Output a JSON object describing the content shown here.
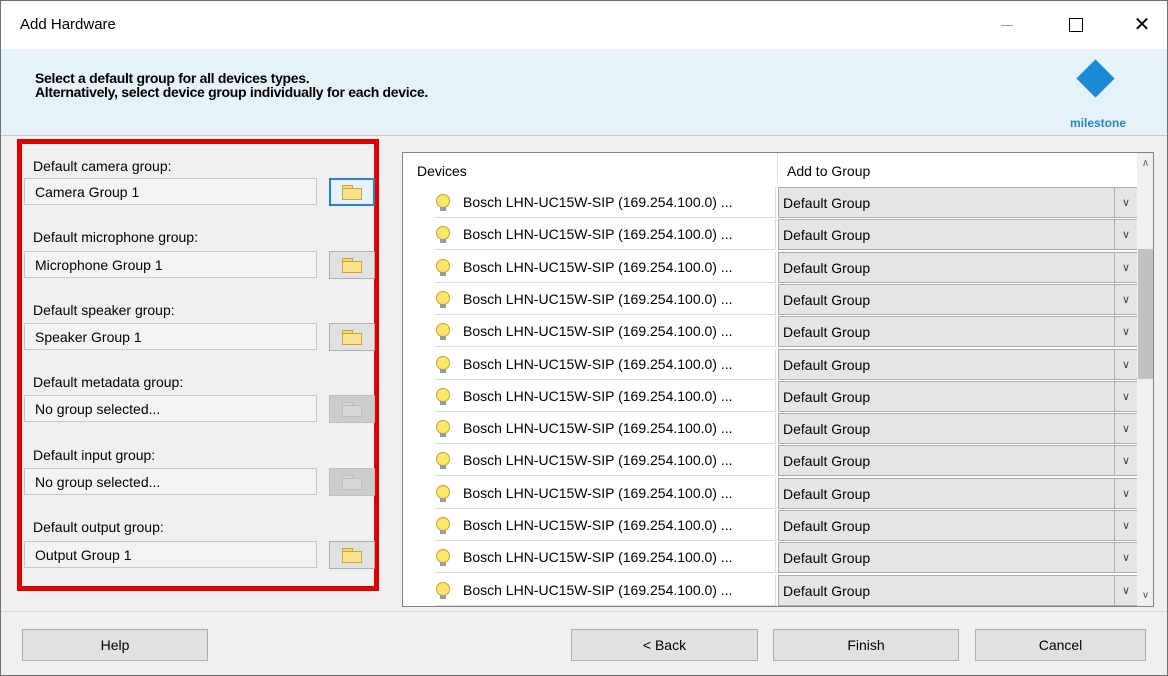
{
  "window": {
    "title": "Add Hardware"
  },
  "header": {
    "line1": "Select a default group for all devices types.",
    "line2": "Alternatively, select device group individually for each device.",
    "logo_text": "milestone",
    "logo_color": "#1a8ad4"
  },
  "defaults": [
    {
      "label": "Default camera group:",
      "value": "Camera Group 1",
      "button_enabled": true
    },
    {
      "label": "Default microphone group:",
      "value": "Microphone Group 1",
      "button_enabled": true
    },
    {
      "label": "Default speaker group:",
      "value": "Speaker Group 1",
      "button_enabled": true
    },
    {
      "label": "Default metadata group:",
      "value": "No group selected...",
      "button_enabled": false
    },
    {
      "label": "Default input group:",
      "value": "No group selected...",
      "button_enabled": false
    },
    {
      "label": "Default output group:",
      "value": "Output Group 1",
      "button_enabled": true
    }
  ],
  "table": {
    "col_devices": "Devices",
    "col_group": "Add to Group",
    "rows": [
      {
        "device": "Bosch LHN-UC15W-SIP (169.254.100.0) ...",
        "group": "Default Group"
      },
      {
        "device": "Bosch LHN-UC15W-SIP (169.254.100.0) ...",
        "group": "Default Group"
      },
      {
        "device": "Bosch LHN-UC15W-SIP (169.254.100.0) ...",
        "group": "Default Group"
      },
      {
        "device": "Bosch LHN-UC15W-SIP (169.254.100.0) ...",
        "group": "Default Group"
      },
      {
        "device": "Bosch LHN-UC15W-SIP (169.254.100.0) ...",
        "group": "Default Group"
      },
      {
        "device": "Bosch LHN-UC15W-SIP (169.254.100.0) ...",
        "group": "Default Group"
      },
      {
        "device": "Bosch LHN-UC15W-SIP (169.254.100.0) ...",
        "group": "Default Group"
      },
      {
        "device": "Bosch LHN-UC15W-SIP (169.254.100.0) ...",
        "group": "Default Group"
      },
      {
        "device": "Bosch LHN-UC15W-SIP (169.254.100.0) ...",
        "group": "Default Group"
      },
      {
        "device": "Bosch LHN-UC15W-SIP (169.254.100.0) ...",
        "group": "Default Group"
      },
      {
        "device": "Bosch LHN-UC15W-SIP (169.254.100.0) ...",
        "group": "Default Group"
      },
      {
        "device": "Bosch LHN-UC15W-SIP (169.254.100.0) ...",
        "group": "Default Group"
      },
      {
        "device": "Bosch LHN-UC15W-SIP (169.254.100.0) ...",
        "group": "Default Group"
      }
    ]
  },
  "footer": {
    "help": "Help",
    "back": "< Back",
    "finish": "Finish",
    "cancel": "Cancel"
  },
  "highlight_color": "#e10000"
}
